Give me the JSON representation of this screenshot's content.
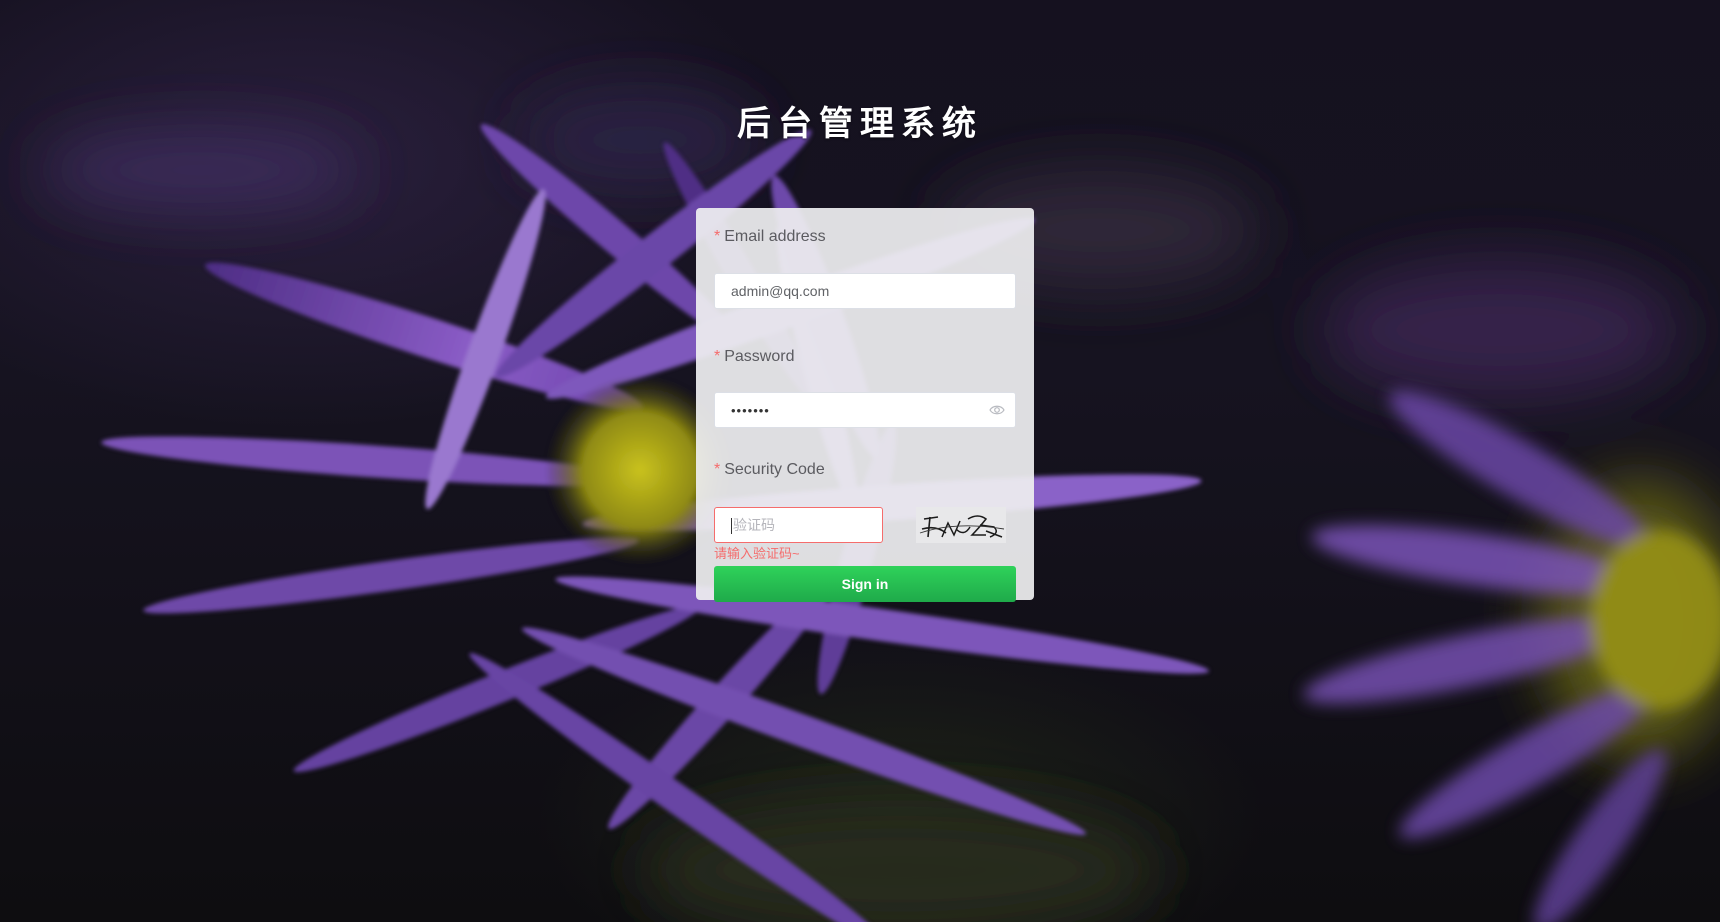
{
  "page": {
    "title": "后台管理系统"
  },
  "form": {
    "email": {
      "required_mark": "*",
      "label": "Email address",
      "value": "admin@qq.com"
    },
    "password": {
      "required_mark": "*",
      "label": "Password",
      "value_masked": "•••••••",
      "toggle_icon": "eye-icon"
    },
    "security_code": {
      "required_mark": "*",
      "label": "Security Code",
      "placeholder": "验证码",
      "error": "请输入验证码~",
      "captcha_icon": "captcha-image"
    },
    "submit_label": "Sign in"
  },
  "colors": {
    "error": "#f56c6c",
    "submit": "#22b24c",
    "card": "#eeeef0"
  }
}
